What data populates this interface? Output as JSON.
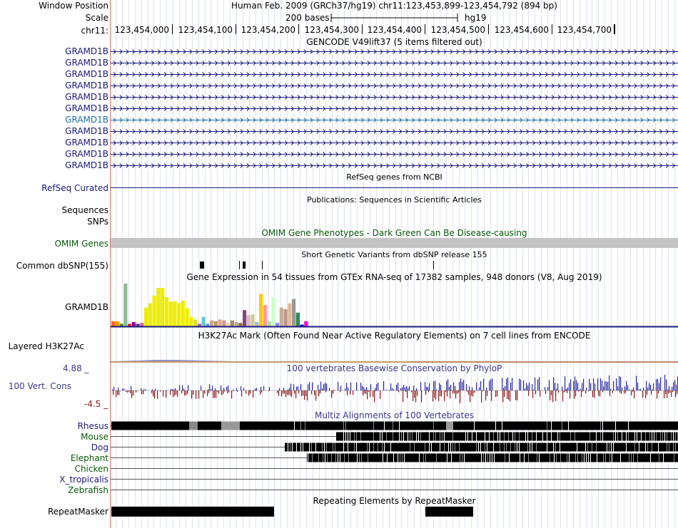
{
  "header": {
    "window_position_label": "Window Position",
    "scale_label": "Scale",
    "chrom_label": "chr11:",
    "assembly_text": "Human Feb. 2009 (GRCh37/hg19)   chr11:123,453,899-123,454,792 (894 bp)",
    "scale_text": "200 bases",
    "scale_db": "hg19",
    "ruler_ticks": [
      "123,454,000",
      "123,454,100",
      "123,454,200",
      "123,454,300",
      "123,454,400",
      "123,454,500",
      "123,454,600",
      "123,454,700"
    ]
  },
  "gencode": {
    "title": "GENCODE V49lift37 (5 items filtered out)",
    "rows": [
      {
        "label": "GRAMD1B",
        "highlight": false
      },
      {
        "label": "GRAMD1B",
        "highlight": false
      },
      {
        "label": "GRAMD1B",
        "highlight": false
      },
      {
        "label": "GRAMD1B",
        "highlight": false
      },
      {
        "label": "GRAMD1B",
        "highlight": false
      },
      {
        "label": "GRAMD1B",
        "highlight": false
      },
      {
        "label": "GRAMD1B",
        "highlight": true
      },
      {
        "label": "GRAMD1B",
        "highlight": false
      },
      {
        "label": "GRAMD1B",
        "highlight": false
      },
      {
        "label": "GRAMD1B",
        "highlight": false
      },
      {
        "label": "GRAMD1B",
        "highlight": false
      }
    ]
  },
  "refseq": {
    "title": "RefSeq genes from NCBI",
    "label": "RefSeq Curated"
  },
  "publications": {
    "title": "Publications: Sequences in Scientific Articles",
    "label_sequences": "Sequences",
    "label_snps": "SNPs"
  },
  "omim": {
    "title": "OMIM Gene Phenotypes - Dark Green Can Be Disease-causing",
    "label": "OMIM Genes"
  },
  "dbsnp": {
    "title": "Short Genetic Variants from dbSNP release 155",
    "label": "Common dbSNP(155)"
  },
  "gtex": {
    "title": "Gene Expression in 54 tissues from GTEx RNA-seq of 17382 samples, 948 donors (V8, Aug 2019)",
    "label": "GRAMD1B",
    "values": [
      6,
      6,
      3,
      50,
      3,
      5,
      3,
      4,
      22,
      27,
      36,
      45,
      45,
      34,
      29,
      29,
      27,
      30,
      21,
      11,
      8,
      3,
      11,
      3,
      7,
      6,
      8,
      7,
      4,
      7,
      5,
      4,
      19,
      13,
      14,
      5,
      38,
      25,
      6,
      34,
      4,
      22,
      20,
      27,
      32,
      16,
      2,
      6
    ],
    "colors": [
      "#ff6600",
      "#ff9900",
      "#2f8f4f",
      "#8fbc8f",
      "#cc3333",
      "#990099",
      "#663399",
      "#cc6699",
      "#eeee00",
      "#eeee00",
      "#eeee00",
      "#eeee00",
      "#eeee00",
      "#eeee00",
      "#eeee00",
      "#eeee00",
      "#eeee00",
      "#eeee00",
      "#eeee00",
      "#eeee00",
      "#dddd44",
      "#9966cc",
      "#66cccc",
      "#6699ff",
      "#ccaa88",
      "#bb9977",
      "#ddaa88",
      "#cc9988",
      "#eeccaa",
      "#aa8866",
      "#bbaa99",
      "#996633",
      "#884488",
      "#ddbbbb",
      "#cccc99",
      "#aabbcc",
      "#ffcc00",
      "#ff9999",
      "#aaddaa",
      "#ccffcc",
      "#8888ff",
      "#ccaa99",
      "#bb9988",
      "#ddbb99",
      "#999999",
      "#2e8b57",
      "#0000ff",
      "#ff00cc"
    ]
  },
  "h3k27ac": {
    "title": "H3K27Ac Mark (Often Found Near Active Regulatory Elements) on 7 cell lines from ENCODE",
    "label": "Layered H3K27Ac"
  },
  "conservation": {
    "title": "100 vertebrates Basewise Conservation by PhyloP",
    "label": "100 Vert. Cons",
    "ymax": "4.88 _",
    "ymin": "-4.5 _"
  },
  "multiz": {
    "title": "Multiz Alignments of 100 Vertebrates",
    "species": [
      {
        "name": "Rhesus",
        "color": "#1a1a7a"
      },
      {
        "name": "Mouse",
        "color": "#0a5a0a"
      },
      {
        "name": "Dog",
        "color": "#1a1a7a"
      },
      {
        "name": "Elephant",
        "color": "#0a5a0a"
      },
      {
        "name": "Chicken",
        "color": "#0a5a0a"
      },
      {
        "name": "X_tropicalis",
        "color": "#1a1a7a"
      },
      {
        "name": "Zebrafish",
        "color": "#0a5a0a"
      }
    ]
  },
  "repeatmasker": {
    "title": "Repeating Elements by RepeatMasker",
    "label": "RepeatMasker"
  }
}
